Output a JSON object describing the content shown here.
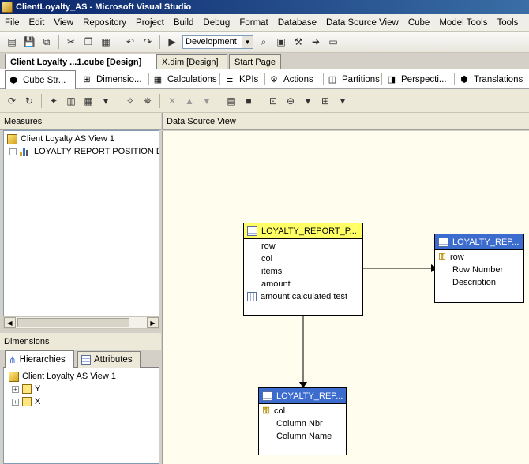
{
  "window": {
    "title": "ClientLoyalty_AS - Microsoft Visual Studio"
  },
  "menu": [
    "File",
    "Edit",
    "View",
    "Repository",
    "Project",
    "Build",
    "Debug",
    "Format",
    "Database",
    "Data Source View",
    "Cube",
    "Model Tools",
    "Tools"
  ],
  "toolbar": {
    "config": "Development"
  },
  "doc_tabs": [
    "Client Loyalty ...1.cube [Design]",
    "X.dim [Design]",
    "Start Page"
  ],
  "designer_tabs": [
    "Cube Str...",
    "Dimensio...",
    "Calculations",
    "KPIs",
    "Actions",
    "Partitions",
    "Perspecti...",
    "Translations"
  ],
  "measures": {
    "header": "Measures",
    "root": "Client Loyalty AS View 1",
    "group": "LOYALTY REPORT POSITION DA"
  },
  "dimensions": {
    "header": "Dimensions",
    "tabs": [
      "Hierarchies",
      "Attributes"
    ],
    "root": "Client Loyalty AS View 1",
    "items": [
      "Y",
      "X"
    ]
  },
  "dsv": {
    "header": "Data Source View",
    "tables": [
      {
        "title": "LOYALTY_REPORT_P...",
        "columns": [
          "row",
          "col",
          "items",
          "amount",
          "amount calculated test"
        ]
      },
      {
        "title": "LOYALTY_REP...",
        "columns": [
          "row",
          "Row Number",
          "Description"
        ]
      },
      {
        "title": "LOYALTY_REP...",
        "columns": [
          "col",
          "Column Nbr",
          "Column Name"
        ]
      }
    ]
  },
  "colors": {
    "fact_header": "#ffff66",
    "dim_header": "#3d6ccf",
    "diagram_bg": "#fffdee"
  }
}
